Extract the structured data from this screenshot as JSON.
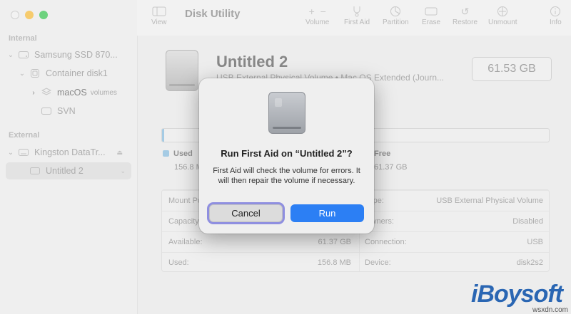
{
  "window": {
    "title": "Disk Utility"
  },
  "toolbar": {
    "view": "View",
    "volume": "Volume",
    "first_aid": "First Aid",
    "partition": "Partition",
    "erase": "Erase",
    "restore": "Restore",
    "unmount": "Unmount",
    "info": "Info"
  },
  "sidebar": {
    "internal_label": "Internal",
    "external_label": "External",
    "items": [
      {
        "label": "Samsung SSD 870...",
        "suffix": ""
      },
      {
        "label": "Container disk1",
        "suffix": ""
      },
      {
        "label": "macOS",
        "suffix": "volumes"
      },
      {
        "label": "SVN",
        "suffix": ""
      },
      {
        "label": "Kingston DataTr...",
        "suffix": ""
      },
      {
        "label": "Untitled 2",
        "suffix": ""
      }
    ]
  },
  "volume": {
    "name": "Untitled 2",
    "subtitle": "USB External Physical Volume • Mac OS Extended (Journ...",
    "capacity": "61.53 GB",
    "used_fraction": 0.0025,
    "used_label": "Used",
    "used_value": "156.8 M",
    "free_label": "Free",
    "free_value": "61.37 GB",
    "used_color": "#7fb5d8"
  },
  "info_table": [
    {
      "k1": "Mount Point:",
      "v1": "",
      "k2": "Type:",
      "v2": "USB External Physical Volume"
    },
    {
      "k1": "Capacity:",
      "v1": "",
      "k2": "Owners:",
      "v2": "Disabled"
    },
    {
      "k1": "Available:",
      "v1": "61.37 GB",
      "k2": "Connection:",
      "v2": "USB"
    },
    {
      "k1": "Used:",
      "v1": "156.8 MB",
      "k2": "Device:",
      "v2": "disk2s2"
    }
  ],
  "dialog": {
    "title": "Run First Aid on “Untitled 2”?",
    "message": "First Aid will check the volume for errors. It will then repair the volume if necessary.",
    "cancel": "Cancel",
    "run": "Run",
    "run_color": "#2c7ff4"
  },
  "watermark": {
    "brand": "iBoysoft",
    "site": "wsxdn.com"
  }
}
